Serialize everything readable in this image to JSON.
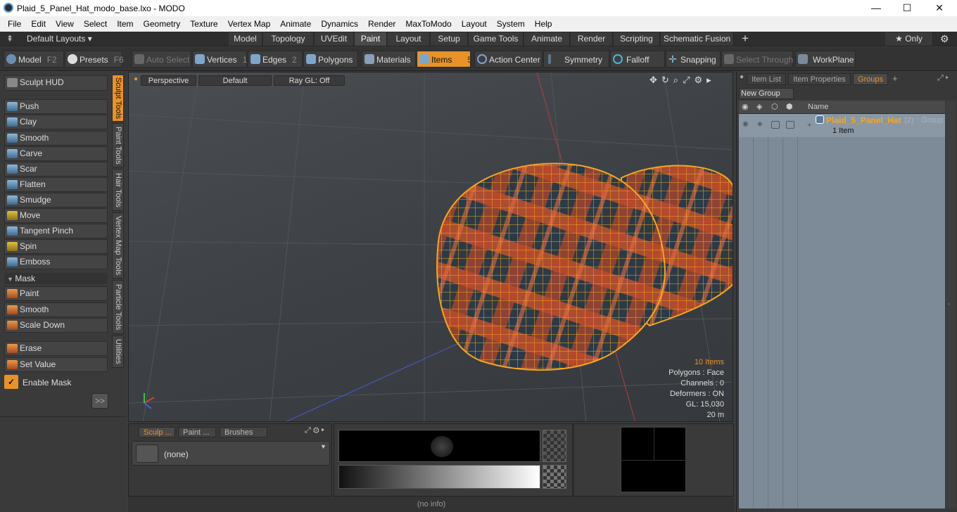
{
  "window": {
    "title": "Plaid_5_Panel_Hat_modo_base.lxo - MODO",
    "minimize": "—",
    "maximize": "☐",
    "close": "✕"
  },
  "menu": [
    "File",
    "Edit",
    "View",
    "Select",
    "Item",
    "Geometry",
    "Texture",
    "Vertex Map",
    "Animate",
    "Dynamics",
    "Render",
    "MaxToModo",
    "Layout",
    "System",
    "Help"
  ],
  "layoutbar": {
    "layouts_label": "Default Layouts ▾",
    "tabs": [
      "Model",
      "Topology",
      "UVEdit",
      "Paint",
      "Layout",
      "Setup",
      "Game Tools",
      "Animate",
      "Render",
      "Scripting",
      "Schematic Fusion"
    ],
    "active_tab": "Paint",
    "add": "+",
    "only_label": "★  Only",
    "gear": "⚙"
  },
  "toolbar": {
    "model": "Model",
    "model_key": "F2",
    "presets": "Presets",
    "presets_key": "F6",
    "auto_select": "Auto Select",
    "vertices": "Vertices",
    "vertices_key": "1",
    "edges": "Edges",
    "edges_key": "2",
    "polygons": "Polygons",
    "materials": "Materials",
    "items": "Items",
    "items_key": "5",
    "action_center": "Action Center",
    "symmetry": "Symmetry",
    "falloff": "Falloff",
    "snapping": "Snapping",
    "select_through": "Select Through",
    "workplane": "WorkPlane"
  },
  "left": {
    "sculpt_hud": "Sculpt HUD",
    "tools": [
      "Push",
      "Clay",
      "Smooth",
      "Carve",
      "Scar",
      "Flatten",
      "Smudge",
      "Move",
      "Tangent Pinch",
      "Spin",
      "Emboss"
    ],
    "mask_header": "Mask",
    "mask_tools": [
      "Paint",
      "Smooth",
      "Scale Down"
    ],
    "erase": "Erase",
    "set_value": "Set Value",
    "enable_mask": "Enable Mask",
    "more": ">>",
    "vtabs": [
      "Sculpt Tools",
      "Paint Tools",
      "Hair Tools",
      "Vertex Map Tools",
      "Particle Tools",
      "Utilities"
    ]
  },
  "viewport": {
    "view": "Perspective",
    "shading": "Default",
    "raygl": "Ray GL: Off",
    "stats": {
      "items": "10 Items",
      "polygons": "Polygons : Face",
      "channels": "Channels : 0",
      "deformers": "Deformers : ON",
      "gl": "GL: 15,030",
      "distance": "20 m"
    }
  },
  "bottom": {
    "tabs": [
      "Sculp ...",
      "Paint ...",
      "Brushes"
    ],
    "preset": "(none)",
    "status": "(no info)"
  },
  "right": {
    "tabs": [
      "Item List",
      "Item Properties",
      "Groups"
    ],
    "new_group": "New Group",
    "name_header": "Name",
    "group_name": "Plaid_5_Panel_Hat",
    "group_count": "(2)",
    "group_type": ": Group",
    "group_items": "1 Item"
  },
  "colors": {
    "accent": "#e8922a",
    "wire": "#f5a623"
  }
}
